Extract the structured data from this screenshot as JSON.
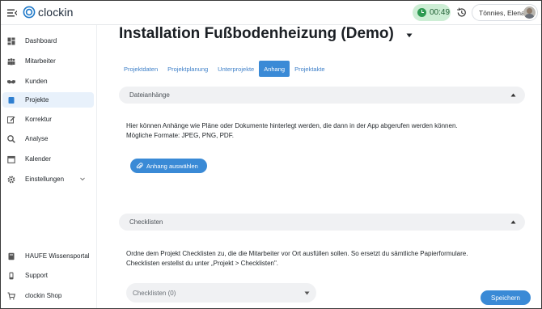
{
  "header": {
    "brand": "clockin",
    "timer": "00:49",
    "user": "Tönnies, Elena"
  },
  "sidebar": {
    "items": [
      {
        "label": "Dashboard",
        "icon": "dashboard-icon"
      },
      {
        "label": "Mitarbeiter",
        "icon": "people-icon"
      },
      {
        "label": "Kunden",
        "icon": "handshake-icon"
      },
      {
        "label": "Projekte",
        "icon": "project-icon"
      },
      {
        "label": "Korrektur",
        "icon": "edit-icon"
      },
      {
        "label": "Analyse",
        "icon": "search-chart-icon"
      },
      {
        "label": "Kalender",
        "icon": "calendar-icon"
      },
      {
        "label": "Einstellungen",
        "icon": "gear-icon"
      }
    ],
    "bottom_items": [
      {
        "label": "HAUFE Wissensportal",
        "icon": "book-icon"
      },
      {
        "label": "Support",
        "icon": "phone-icon"
      },
      {
        "label": "clockin Shop",
        "icon": "cart-icon"
      }
    ]
  },
  "main": {
    "title": "Installation Fußbodenheizung (Demo)",
    "tabs": [
      "Projektdaten",
      "Projektplanung",
      "Unterprojekte",
      "Anhang",
      "Projektakte"
    ],
    "active_tab": "Anhang",
    "attachments": {
      "heading": "Dateianhänge",
      "line1": "Hier können Anhänge wie Pläne oder Dokumente hinterlegt werden, die dann in der App abgerufen werden können.",
      "line2": "Mögliche Formate: JPEG, PNG, PDF.",
      "button": "Anhang auswählen"
    },
    "checklists": {
      "heading": "Checklisten",
      "line1": "Ordne dem Projekt Checklisten zu, die die Mitarbeiter vor Ort ausfüllen sollen. So ersetzt du sämtliche Papierformulare.",
      "line2": "Checklisten erstellst du unter „Projekt > Checklisten\".",
      "select": "Checklisten (0)"
    },
    "save": "Speichern"
  },
  "colors": {
    "accent": "#3a8ad6",
    "timer_bg": "#cdeed5",
    "active_nav_bg": "#e8f1fb"
  }
}
